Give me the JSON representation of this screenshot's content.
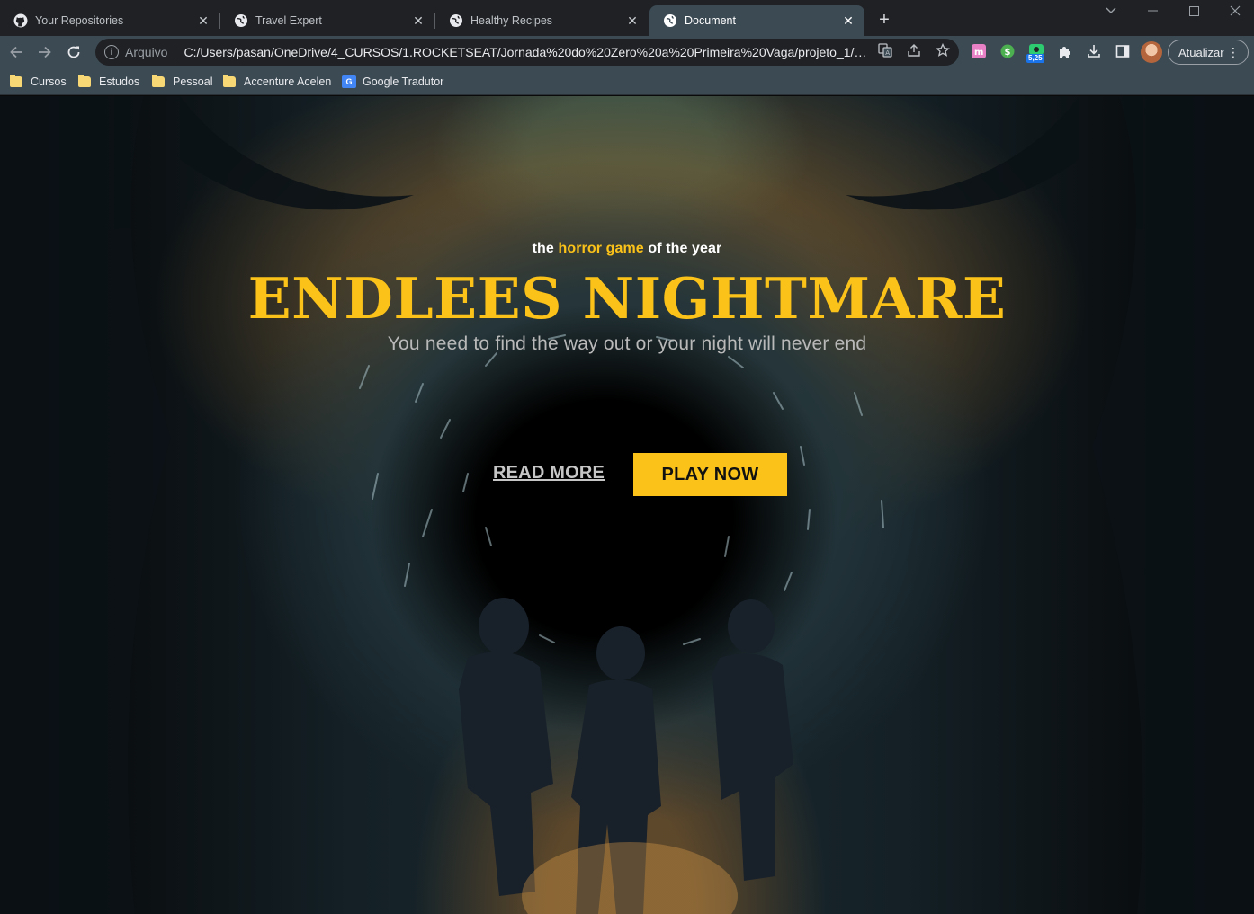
{
  "browser": {
    "tabs": [
      {
        "title": "Your Repositories",
        "icon": "github-icon",
        "active": false
      },
      {
        "title": "Travel Expert",
        "icon": "globe-icon",
        "active": false
      },
      {
        "title": "Healthy Recipes",
        "icon": "globe-icon",
        "active": false
      },
      {
        "title": "Document",
        "icon": "globe-icon",
        "active": true
      }
    ],
    "new_tab_label": "+",
    "address": {
      "scheme_label": "Arquivo",
      "url": "C:/Users/pasan/OneDrive/4_CURSOS/1.ROCKETSEAT/Jornada%20do%20Zero%20a%20Primeira%20Vaga/projeto_1/index...."
    },
    "extension_badge": "5,25",
    "update_label": "Atualizar",
    "bookmarks": [
      {
        "label": "Cursos",
        "icon": "folder-icon"
      },
      {
        "label": "Estudos",
        "icon": "folder-icon"
      },
      {
        "label": "Pessoal",
        "icon": "folder-icon"
      },
      {
        "label": "Accenture Acelen",
        "icon": "folder-icon"
      },
      {
        "label": "Google Tradutor",
        "icon": "google-translate-icon"
      }
    ]
  },
  "hero": {
    "tagline_before": "the ",
    "tagline_highlight": "horror game",
    "tagline_after": " of the year",
    "title": "ENDLEES NIGHTMARE",
    "subtitle": "You need to find the way out or your night will never end",
    "read_more_label": "READ MORE",
    "play_now_label": "PLAY NOW"
  },
  "colors": {
    "accent": "#fbc219",
    "tab_active_bg": "#3c4a54",
    "tabstrip_bg": "#1f2124",
    "omnibox_bg": "#1f2124"
  }
}
